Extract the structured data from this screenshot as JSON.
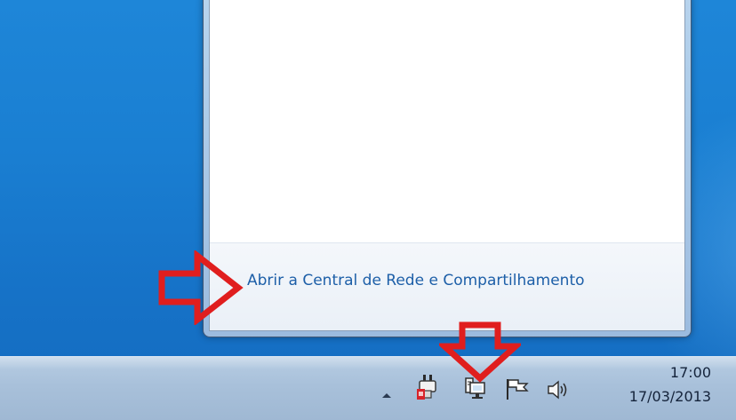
{
  "flyout": {
    "network_center_link": "Abrir a Central de Rede e Compartilhamento"
  },
  "taskbar": {
    "tray_icons": [
      "show-hidden-icons",
      "power-plug-icon",
      "network-icon",
      "action-center-flag-icon",
      "speaker-icon"
    ],
    "clock": {
      "time": "17:00",
      "date": "17/03/2013"
    }
  },
  "colors": {
    "annotation_red": "#e01e1e",
    "link_blue": "#1d5fa8",
    "desktop_blue": "#1a7fd2"
  }
}
